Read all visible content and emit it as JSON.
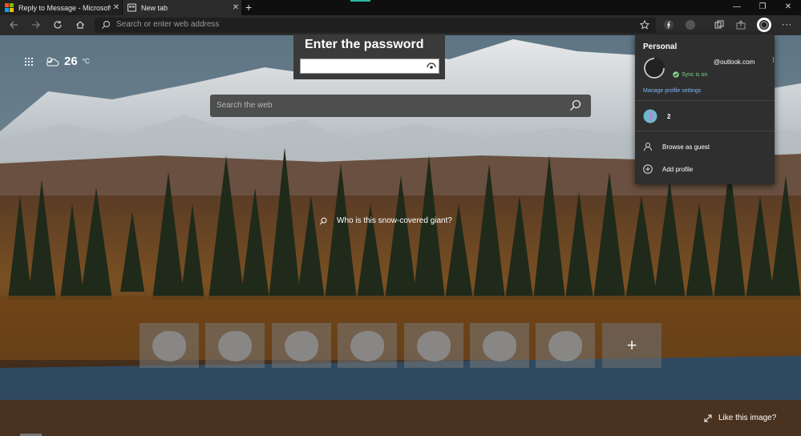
{
  "tabs": [
    {
      "label": "Reply to Message - Microsoft Te",
      "close": "✕"
    },
    {
      "label": "New tab",
      "close": "✕"
    }
  ],
  "new_tab_symbol": "+",
  "window_controls": [
    "—",
    "❐",
    "✕"
  ],
  "address_bar": {
    "placeholder": "Search or enter web address"
  },
  "weather": {
    "temperature": "26",
    "unit": "°C"
  },
  "password_dialog": {
    "title": "Enter the password",
    "value": ""
  },
  "web_search": {
    "placeholder": "Search the web"
  },
  "image_question": "Who is this snow-covered giant?",
  "quick_links": {
    "count": 7,
    "add_label": "+"
  },
  "like_image": "Like this image?",
  "profile_panel": {
    "title": "Personal",
    "email": "@outlook.com",
    "sync_status": "Sync is on",
    "manage_link": "Manage profile settings",
    "other_profile": "2",
    "guest": "Browse as guest",
    "add_profile": "Add profile"
  },
  "icons": [
    "back-arrow-icon",
    "forward-arrow-icon",
    "refresh-icon",
    "home-icon",
    "search-icon",
    "favorite-star-icon",
    "extension-icon",
    "collections-icon",
    "share-icon",
    "profile-avatar-icon",
    "more-icon",
    "apps-grid-icon",
    "weather-cloud-icon",
    "eye-reveal-icon",
    "expand-icon",
    "guest-icon",
    "add-icon",
    "check-icon"
  ],
  "colors": {
    "accent": "#2bb5a4",
    "link": "#7ab8f5",
    "sync": "#7fd18a",
    "panel": "#2f2f2f"
  }
}
